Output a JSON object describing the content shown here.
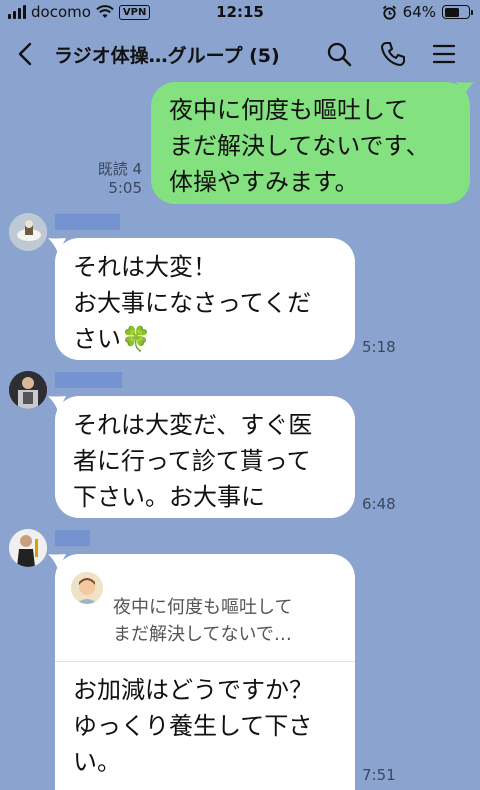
{
  "status_bar": {
    "carrier": "docomo",
    "vpn": "VPN",
    "time": "12:15",
    "battery": "64%",
    "battery_level": 0.64
  },
  "header": {
    "title": "ラジオ体操…グループ (5)",
    "icons": [
      "chevron-left-icon",
      "search-icon",
      "phone-icon",
      "menu-icon"
    ]
  },
  "messages": [
    {
      "direction": "out",
      "lines": [
        "夜中に何度も嘔吐して",
        "まだ解決してないです、",
        "体操やすみます。"
      ],
      "read": "既読 4",
      "time": "5:05"
    },
    {
      "direction": "in",
      "lines": [
        "それは大変！",
        "お大事になさってくだ",
        "さい🍀"
      ],
      "time": "5:18"
    },
    {
      "direction": "in",
      "lines": [
        "それは大変だ、すぐ医",
        "者に行って診て貰って",
        "下さい。お大事に"
      ],
      "time": "6:48"
    },
    {
      "direction": "in",
      "quote_lines": [
        "夜中に何度も嘔吐して",
        "まだ解決してないで…"
      ],
      "lines": [
        "お加減はどうですか？",
        "ゆっくり養生して下さ",
        "い。"
      ],
      "time": "7:51"
    }
  ]
}
